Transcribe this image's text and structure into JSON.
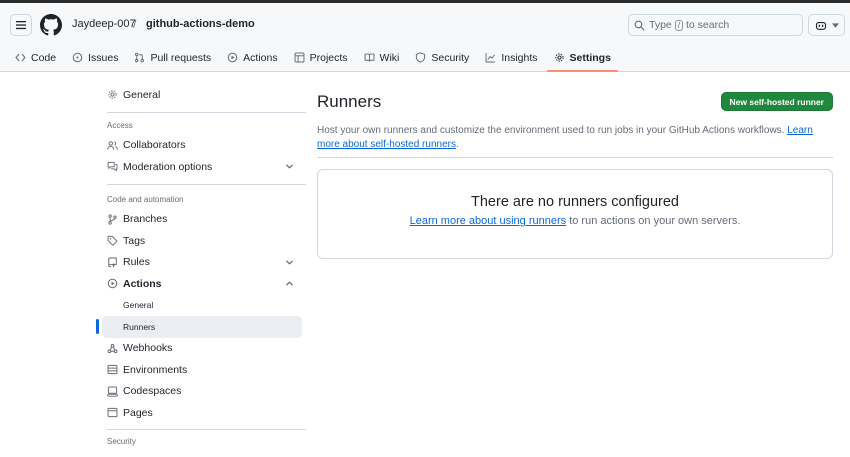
{
  "header": {
    "owner": "Jaydeep-007",
    "slash": "/",
    "repo": "github-actions-demo",
    "search_prefix": "Type",
    "search_key": "/",
    "search_suffix": "to search"
  },
  "tabs": [
    {
      "label": "Code",
      "icon": "code-icon"
    },
    {
      "label": "Issues",
      "icon": "issue-icon"
    },
    {
      "label": "Pull requests",
      "icon": "pull-request-icon"
    },
    {
      "label": "Actions",
      "icon": "play-icon"
    },
    {
      "label": "Projects",
      "icon": "table-icon"
    },
    {
      "label": "Wiki",
      "icon": "book-icon"
    },
    {
      "label": "Security",
      "icon": "shield-icon"
    },
    {
      "label": "Insights",
      "icon": "graph-icon"
    },
    {
      "label": "Settings",
      "icon": "gear-icon",
      "selected": true
    }
  ],
  "sidebar": {
    "general": "General",
    "access_heading": "Access",
    "collaborators": "Collaborators",
    "moderation": "Moderation options",
    "code_heading": "Code and automation",
    "branches": "Branches",
    "tags": "Tags",
    "rules": "Rules",
    "actions": "Actions",
    "actions_general": "General",
    "actions_runners": "Runners",
    "webhooks": "Webhooks",
    "environments": "Environments",
    "codespaces": "Codespaces",
    "pages": "Pages",
    "security_heading": "Security"
  },
  "main": {
    "title": "Runners",
    "new_button": "New self-hosted runner",
    "description": "Host your own runners and customize the environment used to run jobs in your GitHub Actions workflows.",
    "description_link": "Learn more about self-hosted runners",
    "description_end": ".",
    "empty_title": "There are no runners configured",
    "empty_link": "Learn more about using runners",
    "empty_text": "to run actions on your own servers."
  },
  "colors": {
    "accent": "#0969da",
    "primary_button": "#1f883d",
    "selected_tab_underline": "#fd8c73"
  }
}
